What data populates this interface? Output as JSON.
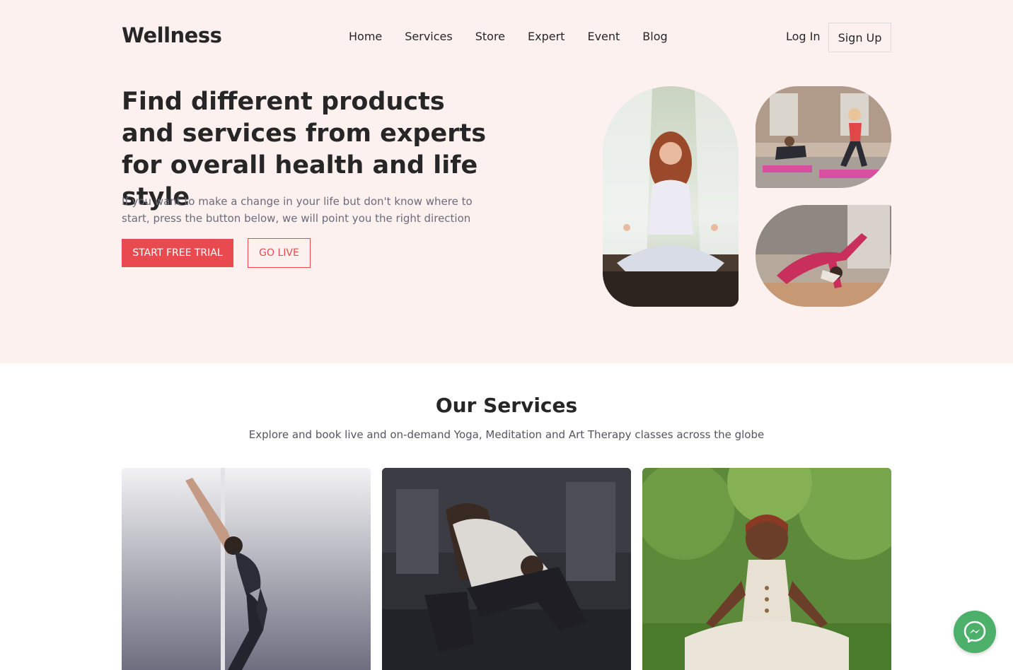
{
  "header": {
    "brand": "Wellness",
    "nav": [
      "Home",
      "Services",
      "Store",
      "Expert",
      "Event",
      "Blog"
    ],
    "login_label": "Log In",
    "signup_label": "Sign Up"
  },
  "hero": {
    "headline": "Find different products and services from experts for overall health and life style",
    "subtext": "If you want to make a change in your life but don't know where to start, press the button below, we will point you the right direction",
    "primary_button": "START FREE TRIAL",
    "secondary_button": "GO LIVE",
    "images": [
      "meditation-photo",
      "group-workout-photo",
      "yoga-stretch-photo"
    ]
  },
  "services": {
    "title": "Our Services",
    "subtitle": "Explore and book live and on-demand Yoga, Meditation and Art Therapy classes across the globe",
    "cards": [
      "yoga-photo",
      "gym-stretch-photo",
      "outdoor-meditation-photo"
    ]
  },
  "colors": {
    "accent": "#e84a4f",
    "hero_background": "#fdf1f0",
    "messenger": "#4caf6a"
  },
  "icons": {
    "chat": "messenger-icon"
  }
}
